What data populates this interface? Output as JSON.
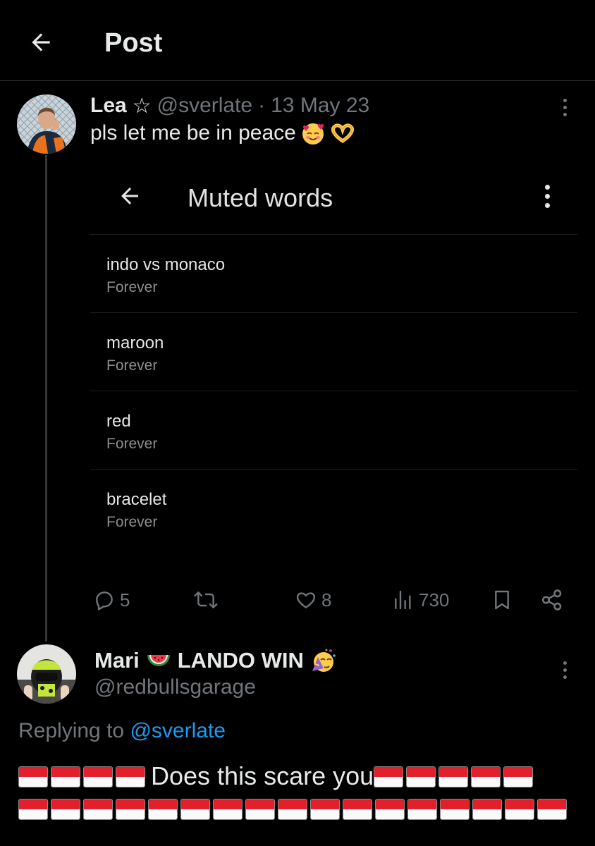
{
  "header": {
    "title": "Post"
  },
  "post": {
    "display_name": "Lea",
    "badge": "☆",
    "handle": "@sverlate",
    "separator": "·",
    "date": "13 May 23",
    "text": "pls let me be in peace",
    "text_emojis": [
      "smiling-face-with-hearts",
      "heart-hands"
    ],
    "embedded_screenshot": {
      "title": "Muted words",
      "items": [
        {
          "word": "indo vs monaco",
          "duration": "Forever"
        },
        {
          "word": "maroon",
          "duration": "Forever"
        },
        {
          "word": "red",
          "duration": "Forever"
        },
        {
          "word": "bracelet",
          "duration": "Forever"
        }
      ]
    },
    "actions": {
      "replies": "5",
      "likes": "8",
      "views": "730"
    }
  },
  "reply": {
    "display_name_part1": "Mari",
    "display_name_part2": "LANDO WIN",
    "name_emojis": [
      "watermelon",
      "partying-face"
    ],
    "handle": "@redbullsgarage",
    "replying_to_prefix": "Replying to",
    "replying_to_handle": "@sverlate",
    "text": "Does this scare you",
    "flag_emoji": "indonesia-flag",
    "flags_before_text": 4,
    "flags_after_text": 5,
    "flags_second_line": 17
  },
  "colors": {
    "background": "#000000",
    "text_primary": "#e7e9ea",
    "text_secondary": "#71767b",
    "link": "#1d9bf0",
    "divider": "#2f3336"
  }
}
